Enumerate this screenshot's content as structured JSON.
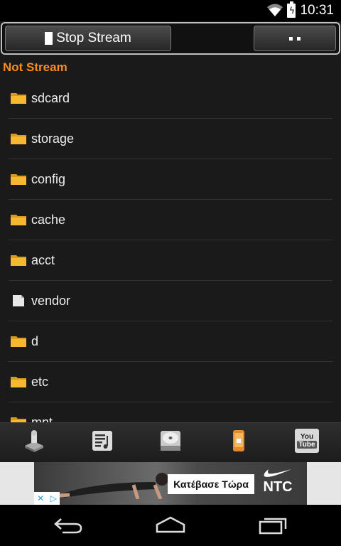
{
  "status_bar": {
    "time": "10:31",
    "icons": [
      "wifi-icon",
      "battery-charging-icon"
    ]
  },
  "toolbar": {
    "stop_label": "Stop Stream",
    "stop_icon": "stop-icon",
    "menu_icon": "dots-icon"
  },
  "stream_status": "Not Stream",
  "files": [
    {
      "name": "sdcard",
      "icon": "folder-icon"
    },
    {
      "name": "storage",
      "icon": "folder-icon"
    },
    {
      "name": "config",
      "icon": "folder-icon"
    },
    {
      "name": "cache",
      "icon": "folder-icon"
    },
    {
      "name": "acct",
      "icon": "folder-icon"
    },
    {
      "name": "vendor",
      "icon": "file-icon"
    },
    {
      "name": "d",
      "icon": "folder-icon"
    },
    {
      "name": "etc",
      "icon": "folder-icon"
    },
    {
      "name": "mnt",
      "icon": "folder-icon"
    }
  ],
  "bottom_bar": {
    "icons": [
      "file-manager-icon",
      "music-playlist-icon",
      "disk-icon",
      "phone-icon",
      "youtube-icon"
    ],
    "youtube_label_top": "You",
    "youtube_label_bottom": "Tube"
  },
  "ad": {
    "cta": "Κατέβασε Τώρα",
    "brand": "NTC"
  },
  "nav_bar": {
    "icons": [
      "back-icon",
      "home-icon",
      "recents-icon"
    ]
  },
  "colors": {
    "accent": "#ff8c1a",
    "folder": "#f5b82e",
    "background": "#1a1a1a"
  }
}
